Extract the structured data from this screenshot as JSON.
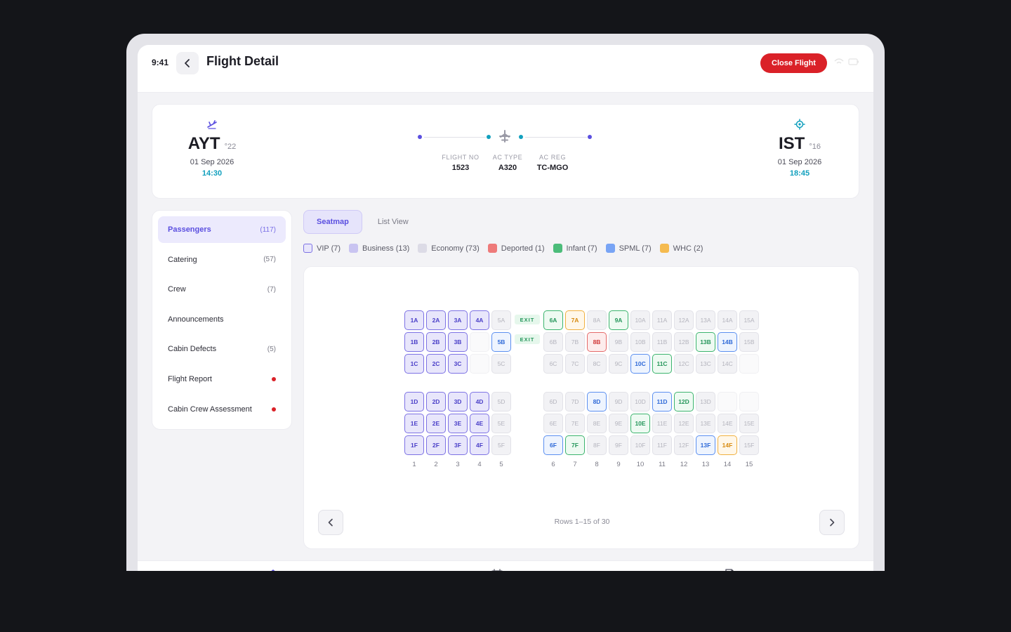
{
  "status_bar": {
    "time": "9:41"
  },
  "header": {
    "title": "Flight Detail",
    "close_label": "Close Flight",
    "icons": [
      "back-chevron-icon",
      "wifi-icon",
      "battery-icon"
    ]
  },
  "flight": {
    "departure": {
      "code": "AYT",
      "temp": "°22",
      "date": "01 Sep 2026",
      "time": "14:30",
      "icon": "takeoff-icon"
    },
    "arrival": {
      "code": "IST",
      "temp": "°16",
      "date": "01 Sep 2026",
      "time": "18:45",
      "icon": "landing-target-icon"
    },
    "flight_no_label": "FLIGHT NO",
    "flight_no": "1523",
    "ac_type_label": "AC TYPE",
    "ac_type": "A320",
    "ac_reg_label": "AC REG",
    "ac_reg": "TC-MGO",
    "route_icon": "airplane-icon",
    "colors": {
      "route_start": "#5b4fe0",
      "route_mid": "#12a0be",
      "time": "#12a0be"
    }
  },
  "sidebar": {
    "items": [
      {
        "label": "Passengers",
        "count": "(117)",
        "active": true
      },
      {
        "label": "Catering",
        "count": "(57)"
      },
      {
        "label": "Crew",
        "count": "(7)"
      },
      {
        "label": "Announcements",
        "count": ""
      },
      {
        "label": "Cabin Defects",
        "count": "(5)"
      },
      {
        "label": "Flight Report",
        "count": "",
        "alert": true
      },
      {
        "label": "Cabin Crew Assessment",
        "count": "",
        "alert": true
      }
    ]
  },
  "tabs": [
    {
      "label": "Seatmap",
      "active": true
    },
    {
      "label": "List View"
    }
  ],
  "legend": [
    {
      "label": "VIP (7)",
      "color": "#e8e6fb",
      "border": "#7d72e4"
    },
    {
      "label": "Business (13)",
      "color": "#c9c4f1",
      "border": "#c9c4f1"
    },
    {
      "label": "Economy (73)",
      "color": "#dcdbe6",
      "border": "#dcdbe6"
    },
    {
      "label": "Deported (1)",
      "color": "#ee7a7a",
      "border": "#ee7a7a"
    },
    {
      "label": "Infant (7)",
      "color": "#4cbc7a",
      "border": "#4cbc7a"
    },
    {
      "label": "SPML (7)",
      "color": "#78a4f5",
      "border": "#78a4f5"
    },
    {
      "label": "WHC (2)",
      "color": "#f5bb50",
      "border": "#f5bb50"
    }
  ],
  "seatmap": {
    "letters_upper": [
      "A",
      "B",
      "C"
    ],
    "letters_lower": [
      "D",
      "E",
      "F"
    ],
    "rows": [
      1,
      2,
      3,
      4,
      5,
      6,
      7,
      8,
      9,
      10,
      11,
      12,
      13,
      14,
      15
    ],
    "exit_label": "EXIT",
    "special": {
      "1A": "vip",
      "1B": "vip",
      "1C": "vip",
      "1D": "vip",
      "1E": "vip",
      "1F": "vip",
      "2A": "vip",
      "2B": "vip",
      "2C": "vip",
      "2D": "vip",
      "2E": "vip",
      "2F": "vip",
      "3A": "vip",
      "3B": "vip",
      "3C": "vip",
      "3D": "vip",
      "3E": "vip",
      "3F": "vip",
      "4A": "vip",
      "4D": "vip",
      "4E": "vip",
      "4F": "vip",
      "4B": "blank",
      "4C": "blank",
      "5B": "spml",
      "6A": "infant",
      "7A": "whc",
      "9A": "infant",
      "8B": "deported",
      "13B": "infant",
      "14B": "spml",
      "10C": "spml",
      "11C": "infant",
      "15C": "blank",
      "8D": "spml",
      "11D": "spml",
      "12D": "infant",
      "14D": "blank",
      "15D": "blank",
      "10E": "infant",
      "6F": "spml",
      "7F": "infant",
      "13F": "spml",
      "14F": "whc"
    },
    "pagination": {
      "info": "Rows 1–15 of 30",
      "prev_icon": "chevron-left-icon",
      "next_icon": "chevron-right-icon"
    }
  },
  "bottom_nav": {
    "items": [
      {
        "icon": "home-icon"
      },
      {
        "icon": "calendar-icon"
      },
      {
        "icon": "document-icon"
      }
    ]
  }
}
